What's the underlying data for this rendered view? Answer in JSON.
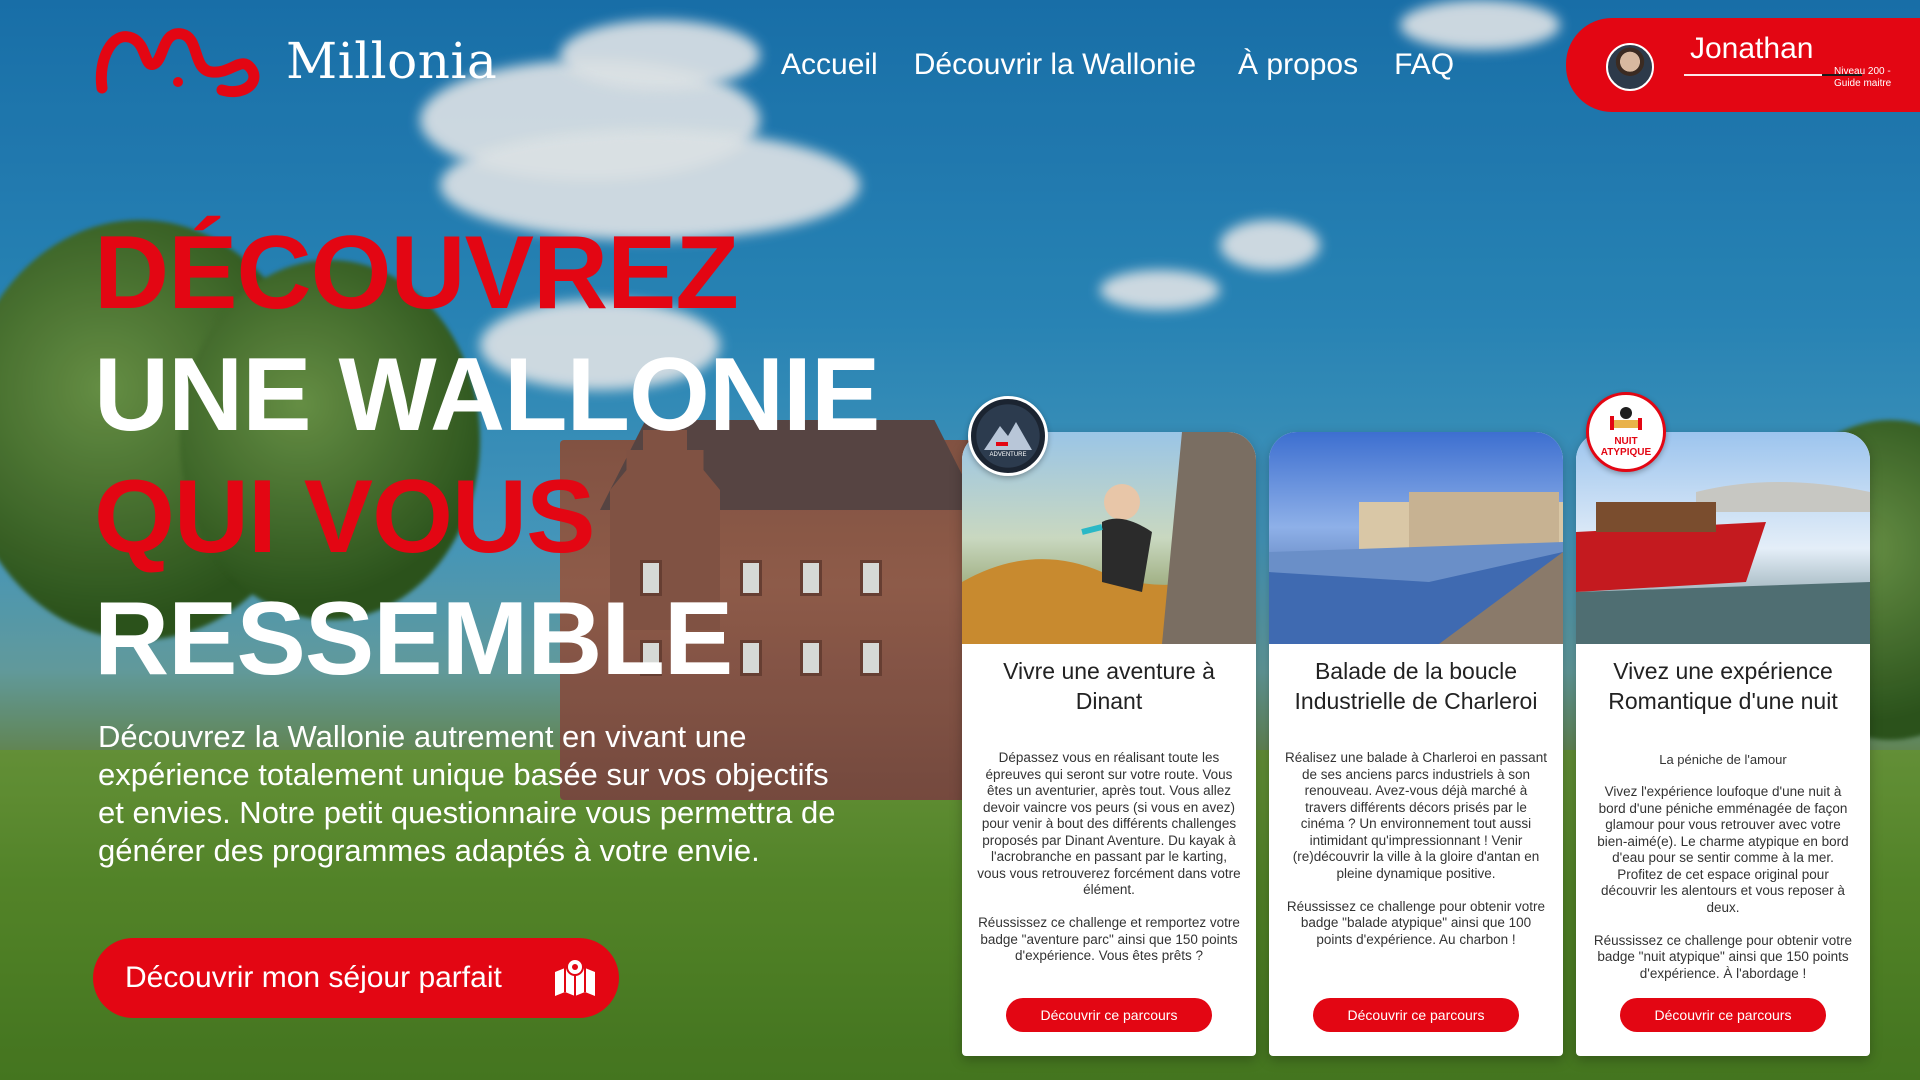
{
  "header": {
    "logo_text": "Millonia",
    "nav": [
      "Accueil",
      "Découvrir la Wallonie",
      "À propos",
      "FAQ"
    ],
    "user": {
      "name": "Jonathan",
      "level": "Niveau 200 - Guide maitre"
    }
  },
  "hero": {
    "line1": "DÉCOUVREZ",
    "line2": "UNE WALLONIE",
    "line3": "QUI VOUS",
    "line4": "RESSEMBLE",
    "text": "Découvrez la Wallonie autrement en vivant une expérience totalement unique basée sur vos objectifs et envies. Notre petit questionnaire vous permettra de générer des programmes adaptés à votre envie.",
    "cta": "Découvrir mon séjour parfait"
  },
  "cards": [
    {
      "title": "Vivre une aventure à Dinant",
      "subtitle": "",
      "body": "Dépassez vous en réalisant toute les épreuves qui seront sur votre route. Vous êtes un aventurier, après tout. Vous allez devoir vaincre vos peurs (si vous en avez) pour venir à bout des différents challenges proposés par Dinant Aventure. Du kayak à l'acrobranche en passant par le karting, vous vous retrouverez forcément dans votre élément.\n\nRéussissez ce challenge et remportez votre badge \"aventure parc\" ainsi que 150 points d'expérience. Vous êtes prêts ?",
      "button": "Découvrir ce parcours",
      "badge": "ADVENTURE"
    },
    {
      "title": "Balade de la boucle Industrielle de Charleroi",
      "subtitle": "",
      "body": "Réalisez une balade à Charleroi en passant de ses anciens parcs industriels à son renouveau. Avez-vous déjà marché à travers différents décors prisés par le cinéma ? Un environnement tout aussi intimidant qu'impressionnant ! Venir (re)découvrir la ville à la gloire d'antan en pleine dynamique positive.\n\nRéussissez ce challenge pour obtenir votre badge \"balade atypique\" ainsi que 100 points d'expérience. Au charbon !",
      "button": "Découvrir ce parcours",
      "badge": ""
    },
    {
      "title": "Vivez une expérience Romantique d'une nuit",
      "subtitle": "La péniche de l'amour",
      "body": "Vivez l'expérience loufoque d'une nuit à bord d'une péniche emménagée de façon glamour pour vous retrouver avec votre bien-aimé(e). Le charme atypique en bord d'eau pour se sentir comme à la mer. Profitez de cet espace original pour découvrir les alentours et vous reposer à deux.\n\nRéussissez ce challenge pour obtenir votre badge \"nuit atypique\" ainsi que 150 points d'expérience. À l'abordage !",
      "button": "Découvrir ce parcours",
      "badge": "NUIT ATYPIQUE"
    }
  ],
  "colors": {
    "brand": "#e30613",
    "text_white": "#ffffff"
  },
  "icons": [
    "map-pin-icon",
    "avatar",
    "millonia-logo-icon"
  ]
}
